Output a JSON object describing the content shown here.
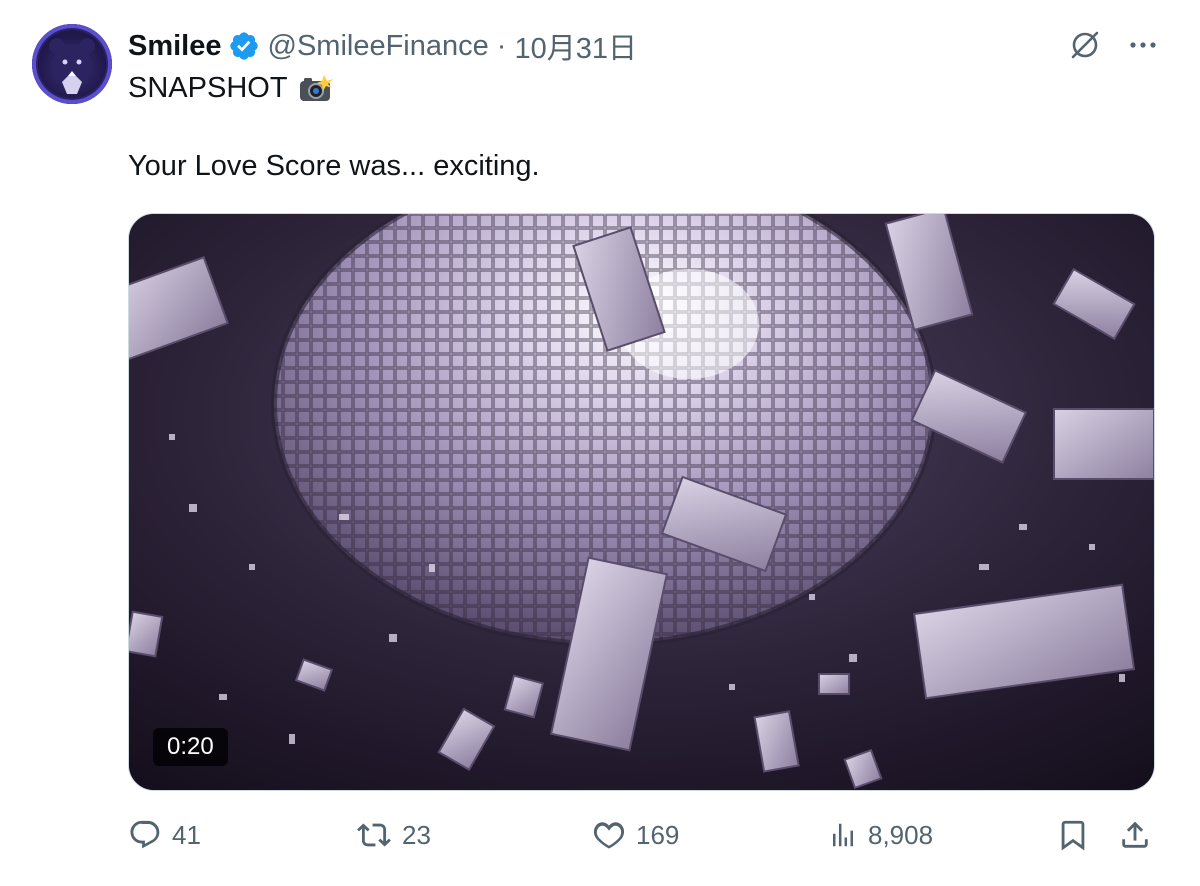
{
  "author": {
    "name": "Smilee",
    "handle": "@SmileeFinance",
    "separator": "·",
    "date": "10月31日"
  },
  "icons": {
    "verified": "verified-badge-icon",
    "grok": "grok-icon",
    "more": "more-icon",
    "camera": "camera-flash-emoji",
    "reply": "reply-icon",
    "retweet": "retweet-icon",
    "like": "like-icon",
    "views": "views-icon",
    "bookmark": "bookmark-icon",
    "share": "share-icon"
  },
  "tweet": {
    "line1": "SNAPSHOT",
    "line2": "Your Love Score was... exciting."
  },
  "media": {
    "type": "video",
    "duration": "0:20"
  },
  "actions": {
    "replies": "41",
    "retweets": "23",
    "likes": "169",
    "views": "8,908"
  },
  "colors": {
    "verified": "#1d9bf0",
    "secondary_text": "#536471",
    "primary_text": "#0f1419"
  }
}
